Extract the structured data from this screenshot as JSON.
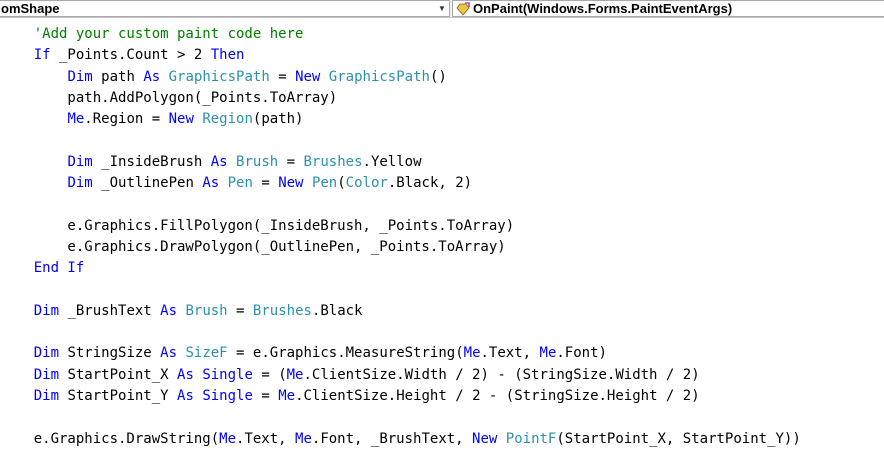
{
  "nav": {
    "class_dropdown": "omShape",
    "member_dropdown": "OnPaint(Windows.Forms.PaintEventArgs)"
  },
  "code": {
    "lines": [
      [
        {
          "t": "    ",
          "c": ""
        },
        {
          "t": "'Add your custom paint code here",
          "c": "cm"
        }
      ],
      [
        {
          "t": "    ",
          "c": ""
        },
        {
          "t": "If",
          "c": "kw"
        },
        {
          "t": " _Points.Count > 2 ",
          "c": ""
        },
        {
          "t": "Then",
          "c": "kw"
        }
      ],
      [
        {
          "t": "        ",
          "c": ""
        },
        {
          "t": "Dim",
          "c": "kw"
        },
        {
          "t": " path ",
          "c": ""
        },
        {
          "t": "As",
          "c": "kw"
        },
        {
          "t": " ",
          "c": ""
        },
        {
          "t": "GraphicsPath",
          "c": "ty"
        },
        {
          "t": " = ",
          "c": ""
        },
        {
          "t": "New",
          "c": "kw"
        },
        {
          "t": " ",
          "c": ""
        },
        {
          "t": "GraphicsPath",
          "c": "ty"
        },
        {
          "t": "()",
          "c": ""
        }
      ],
      [
        {
          "t": "        path.AddPolygon(_Points.ToArray)",
          "c": ""
        }
      ],
      [
        {
          "t": "        ",
          "c": ""
        },
        {
          "t": "Me",
          "c": "kw"
        },
        {
          "t": ".Region = ",
          "c": ""
        },
        {
          "t": "New",
          "c": "kw"
        },
        {
          "t": " ",
          "c": ""
        },
        {
          "t": "Region",
          "c": "ty"
        },
        {
          "t": "(path)",
          "c": ""
        }
      ],
      [],
      [
        {
          "t": "        ",
          "c": ""
        },
        {
          "t": "Dim",
          "c": "kw"
        },
        {
          "t": " _InsideBrush ",
          "c": ""
        },
        {
          "t": "As",
          "c": "kw"
        },
        {
          "t": " ",
          "c": ""
        },
        {
          "t": "Brush",
          "c": "ty"
        },
        {
          "t": " = ",
          "c": ""
        },
        {
          "t": "Brushes",
          "c": "ty"
        },
        {
          "t": ".Yellow",
          "c": ""
        }
      ],
      [
        {
          "t": "        ",
          "c": ""
        },
        {
          "t": "Dim",
          "c": "kw"
        },
        {
          "t": " _OutlinePen ",
          "c": ""
        },
        {
          "t": "As",
          "c": "kw"
        },
        {
          "t": " ",
          "c": ""
        },
        {
          "t": "Pen",
          "c": "ty"
        },
        {
          "t": " = ",
          "c": ""
        },
        {
          "t": "New",
          "c": "kw"
        },
        {
          "t": " ",
          "c": ""
        },
        {
          "t": "Pen",
          "c": "ty"
        },
        {
          "t": "(",
          "c": ""
        },
        {
          "t": "Color",
          "c": "ty"
        },
        {
          "t": ".Black, 2)",
          "c": ""
        }
      ],
      [],
      [
        {
          "t": "        e.Graphics.FillPolygon(_InsideBrush, _Points.ToArray)",
          "c": ""
        }
      ],
      [
        {
          "t": "        e.Graphics.DrawPolygon(_OutlinePen, _Points.ToArray)",
          "c": ""
        }
      ],
      [
        {
          "t": "    ",
          "c": ""
        },
        {
          "t": "End If",
          "c": "kw"
        }
      ],
      [],
      [
        {
          "t": "    ",
          "c": ""
        },
        {
          "t": "Dim",
          "c": "kw"
        },
        {
          "t": " _BrushText ",
          "c": ""
        },
        {
          "t": "As",
          "c": "kw"
        },
        {
          "t": " ",
          "c": ""
        },
        {
          "t": "Brush",
          "c": "ty"
        },
        {
          "t": " = ",
          "c": ""
        },
        {
          "t": "Brushes",
          "c": "ty"
        },
        {
          "t": ".Black",
          "c": ""
        }
      ],
      [],
      [
        {
          "t": "    ",
          "c": ""
        },
        {
          "t": "Dim",
          "c": "kw"
        },
        {
          "t": " StringSize ",
          "c": ""
        },
        {
          "t": "As",
          "c": "kw"
        },
        {
          "t": " ",
          "c": ""
        },
        {
          "t": "SizeF",
          "c": "ty"
        },
        {
          "t": " = e.Graphics.MeasureString(",
          "c": ""
        },
        {
          "t": "Me",
          "c": "kw"
        },
        {
          "t": ".Text, ",
          "c": ""
        },
        {
          "t": "Me",
          "c": "kw"
        },
        {
          "t": ".Font)",
          "c": ""
        }
      ],
      [
        {
          "t": "    ",
          "c": ""
        },
        {
          "t": "Dim",
          "c": "kw"
        },
        {
          "t": " StartPoint_X ",
          "c": ""
        },
        {
          "t": "As",
          "c": "kw"
        },
        {
          "t": " ",
          "c": ""
        },
        {
          "t": "Single",
          "c": "kw"
        },
        {
          "t": " = (",
          "c": ""
        },
        {
          "t": "Me",
          "c": "kw"
        },
        {
          "t": ".ClientSize.Width / 2) - (StringSize.Width / 2)",
          "c": ""
        }
      ],
      [
        {
          "t": "    ",
          "c": ""
        },
        {
          "t": "Dim",
          "c": "kw"
        },
        {
          "t": " StartPoint_Y ",
          "c": ""
        },
        {
          "t": "As",
          "c": "kw"
        },
        {
          "t": " ",
          "c": ""
        },
        {
          "t": "Single",
          "c": "kw"
        },
        {
          "t": " = ",
          "c": ""
        },
        {
          "t": "Me",
          "c": "kw"
        },
        {
          "t": ".ClientSize.Height / 2 - (StringSize.Height / 2)",
          "c": ""
        }
      ],
      [],
      [
        {
          "t": "    e.Graphics.DrawString(",
          "c": ""
        },
        {
          "t": "Me",
          "c": "kw"
        },
        {
          "t": ".Text, ",
          "c": ""
        },
        {
          "t": "Me",
          "c": "kw"
        },
        {
          "t": ".Font, _BrushText, ",
          "c": ""
        },
        {
          "t": "New",
          "c": "kw"
        },
        {
          "t": " ",
          "c": ""
        },
        {
          "t": "PointF",
          "c": "ty"
        },
        {
          "t": "(StartPoint_X, StartPoint_Y))",
          "c": ""
        }
      ]
    ]
  }
}
